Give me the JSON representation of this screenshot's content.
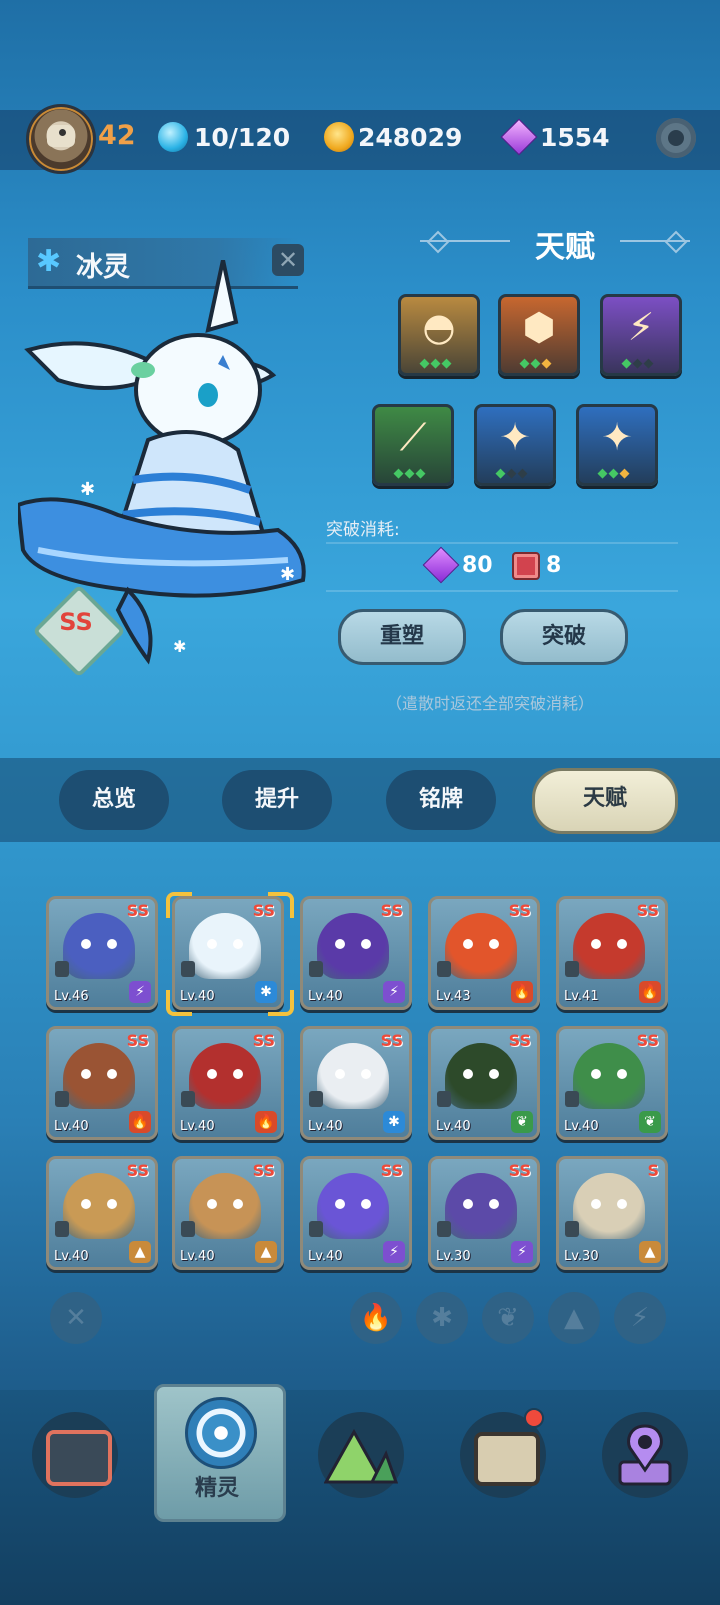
{
  "header": {
    "player_level": "42",
    "stamina": "10/120",
    "coins": "248029",
    "gems": "1554"
  },
  "hero": {
    "name": "冰灵",
    "grade": "SS"
  },
  "talent": {
    "title": "天赋",
    "breakthrough_label": "突破消耗:",
    "cost_gems": "80",
    "cost_books": "8",
    "reforge_label": "重塑",
    "breakthrough_button": "突破",
    "hint": "（遣散时返还全部突破消耗）",
    "slots": [
      {
        "icon": "bowls-icon",
        "color": "#b98a40",
        "gems": [
          "on",
          "on",
          "on"
        ]
      },
      {
        "icon": "red-gem-icon",
        "color": "#c7672f",
        "gems": [
          "on",
          "on",
          "gold"
        ]
      },
      {
        "icon": "lightning-icon",
        "color": "#7c4fc4",
        "gems": [
          "on",
          "off",
          "off"
        ]
      },
      {
        "icon": "claw-icon",
        "color": "#3f8a45",
        "gems": [
          "on",
          "on",
          "on"
        ]
      },
      {
        "icon": "sparkle-icon",
        "color": "#2f6fbf",
        "gems": [
          "on",
          "off",
          "off"
        ]
      },
      {
        "icon": "sparkle-icon",
        "color": "#2f6fbf",
        "gems": [
          "on",
          "on",
          "gold"
        ]
      }
    ]
  },
  "tabs": [
    {
      "label": "总览",
      "active": false
    },
    {
      "label": "提升",
      "active": false
    },
    {
      "label": "铭牌",
      "active": false
    },
    {
      "label": "天赋",
      "active": true
    }
  ],
  "roster": [
    {
      "grade": "SS",
      "level": "Lv.46",
      "element": "⚡",
      "elem_color": "#7d4fd0",
      "color": "#4b5fc0"
    },
    {
      "grade": "SS",
      "level": "Lv.40",
      "element": "✱",
      "elem_color": "#2c8ad8",
      "color": "#e9f4fb"
    },
    {
      "grade": "SS",
      "level": "Lv.40",
      "element": "⚡",
      "elem_color": "#7d4fd0",
      "color": "#5a3aa8"
    },
    {
      "grade": "SS",
      "level": "Lv.43",
      "element": "🔥",
      "elem_color": "#d94a2a",
      "color": "#e2552b"
    },
    {
      "grade": "SS",
      "level": "Lv.41",
      "element": "🔥",
      "elem_color": "#d94a2a",
      "color": "#c53a2d"
    },
    {
      "grade": "SS",
      "level": "Lv.40",
      "element": "🔥",
      "elem_color": "#d94a2a",
      "color": "#9a5434"
    },
    {
      "grade": "SS",
      "level": "Lv.40",
      "element": "🔥",
      "elem_color": "#d94a2a",
      "color": "#b3302e"
    },
    {
      "grade": "SS",
      "level": "Lv.40",
      "element": "✱",
      "elem_color": "#2c8ad8",
      "color": "#eaeef2"
    },
    {
      "grade": "SS",
      "level": "Lv.40",
      "element": "❦",
      "elem_color": "#3a9a4a",
      "color": "#2d4a2a"
    },
    {
      "grade": "SS",
      "level": "Lv.40",
      "element": "❦",
      "elem_color": "#3a9a4a",
      "color": "#3f8e4a"
    },
    {
      "grade": "SS",
      "level": "Lv.40",
      "element": "▲",
      "elem_color": "#c98a3a",
      "color": "#c99a55"
    },
    {
      "grade": "SS",
      "level": "Lv.40",
      "element": "▲",
      "elem_color": "#c98a3a",
      "color": "#c79356"
    },
    {
      "grade": "SS",
      "level": "Lv.40",
      "element": "⚡",
      "elem_color": "#7d4fd0",
      "color": "#6a55d6"
    },
    {
      "grade": "SS",
      "level": "Lv.30",
      "element": "⚡",
      "elem_color": "#7d4fd0",
      "color": "#5c4aa8"
    },
    {
      "grade": "S",
      "level": "Lv.30",
      "element": "▲",
      "elem_color": "#c98a3a",
      "color": "#d9cfb6"
    }
  ],
  "filters": [
    "✕",
    "🔥",
    "✱",
    "❦",
    "▲",
    "⚡"
  ],
  "nav": {
    "active_label": "精灵"
  }
}
